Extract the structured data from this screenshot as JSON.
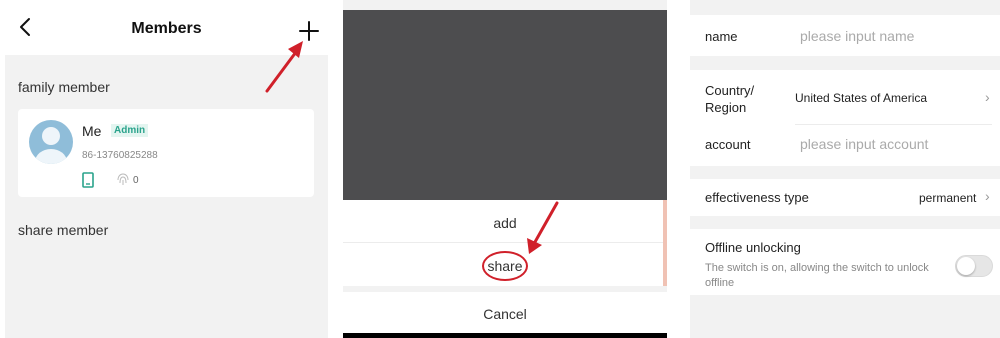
{
  "members_screen": {
    "title": "Members",
    "family_section_label": "family member",
    "share_section_label": "share member",
    "member": {
      "name": "Me",
      "role_badge": "Admin",
      "phone": "86-13760825288",
      "fingerprint_count": "0"
    }
  },
  "action_sheet": {
    "options": [
      "add",
      "share"
    ],
    "cancel_label": "Cancel"
  },
  "share_form": {
    "name_label": "name",
    "name_placeholder": "please input name",
    "country_label": "Country/\nRegion",
    "country_value": "United States of America",
    "account_label": "account",
    "account_placeholder": "please input account",
    "effectiveness_label": "effectiveness type",
    "effectiveness_value": "permanent",
    "offline_label": "Offline unlocking",
    "offline_description": "The switch is on, allowing the switch to unlock offline",
    "offline_enabled": false
  },
  "colors": {
    "annotation_red": "#d0202a",
    "badge_green": "#2aa38c",
    "avatar_blue": "#8fbdd9"
  }
}
